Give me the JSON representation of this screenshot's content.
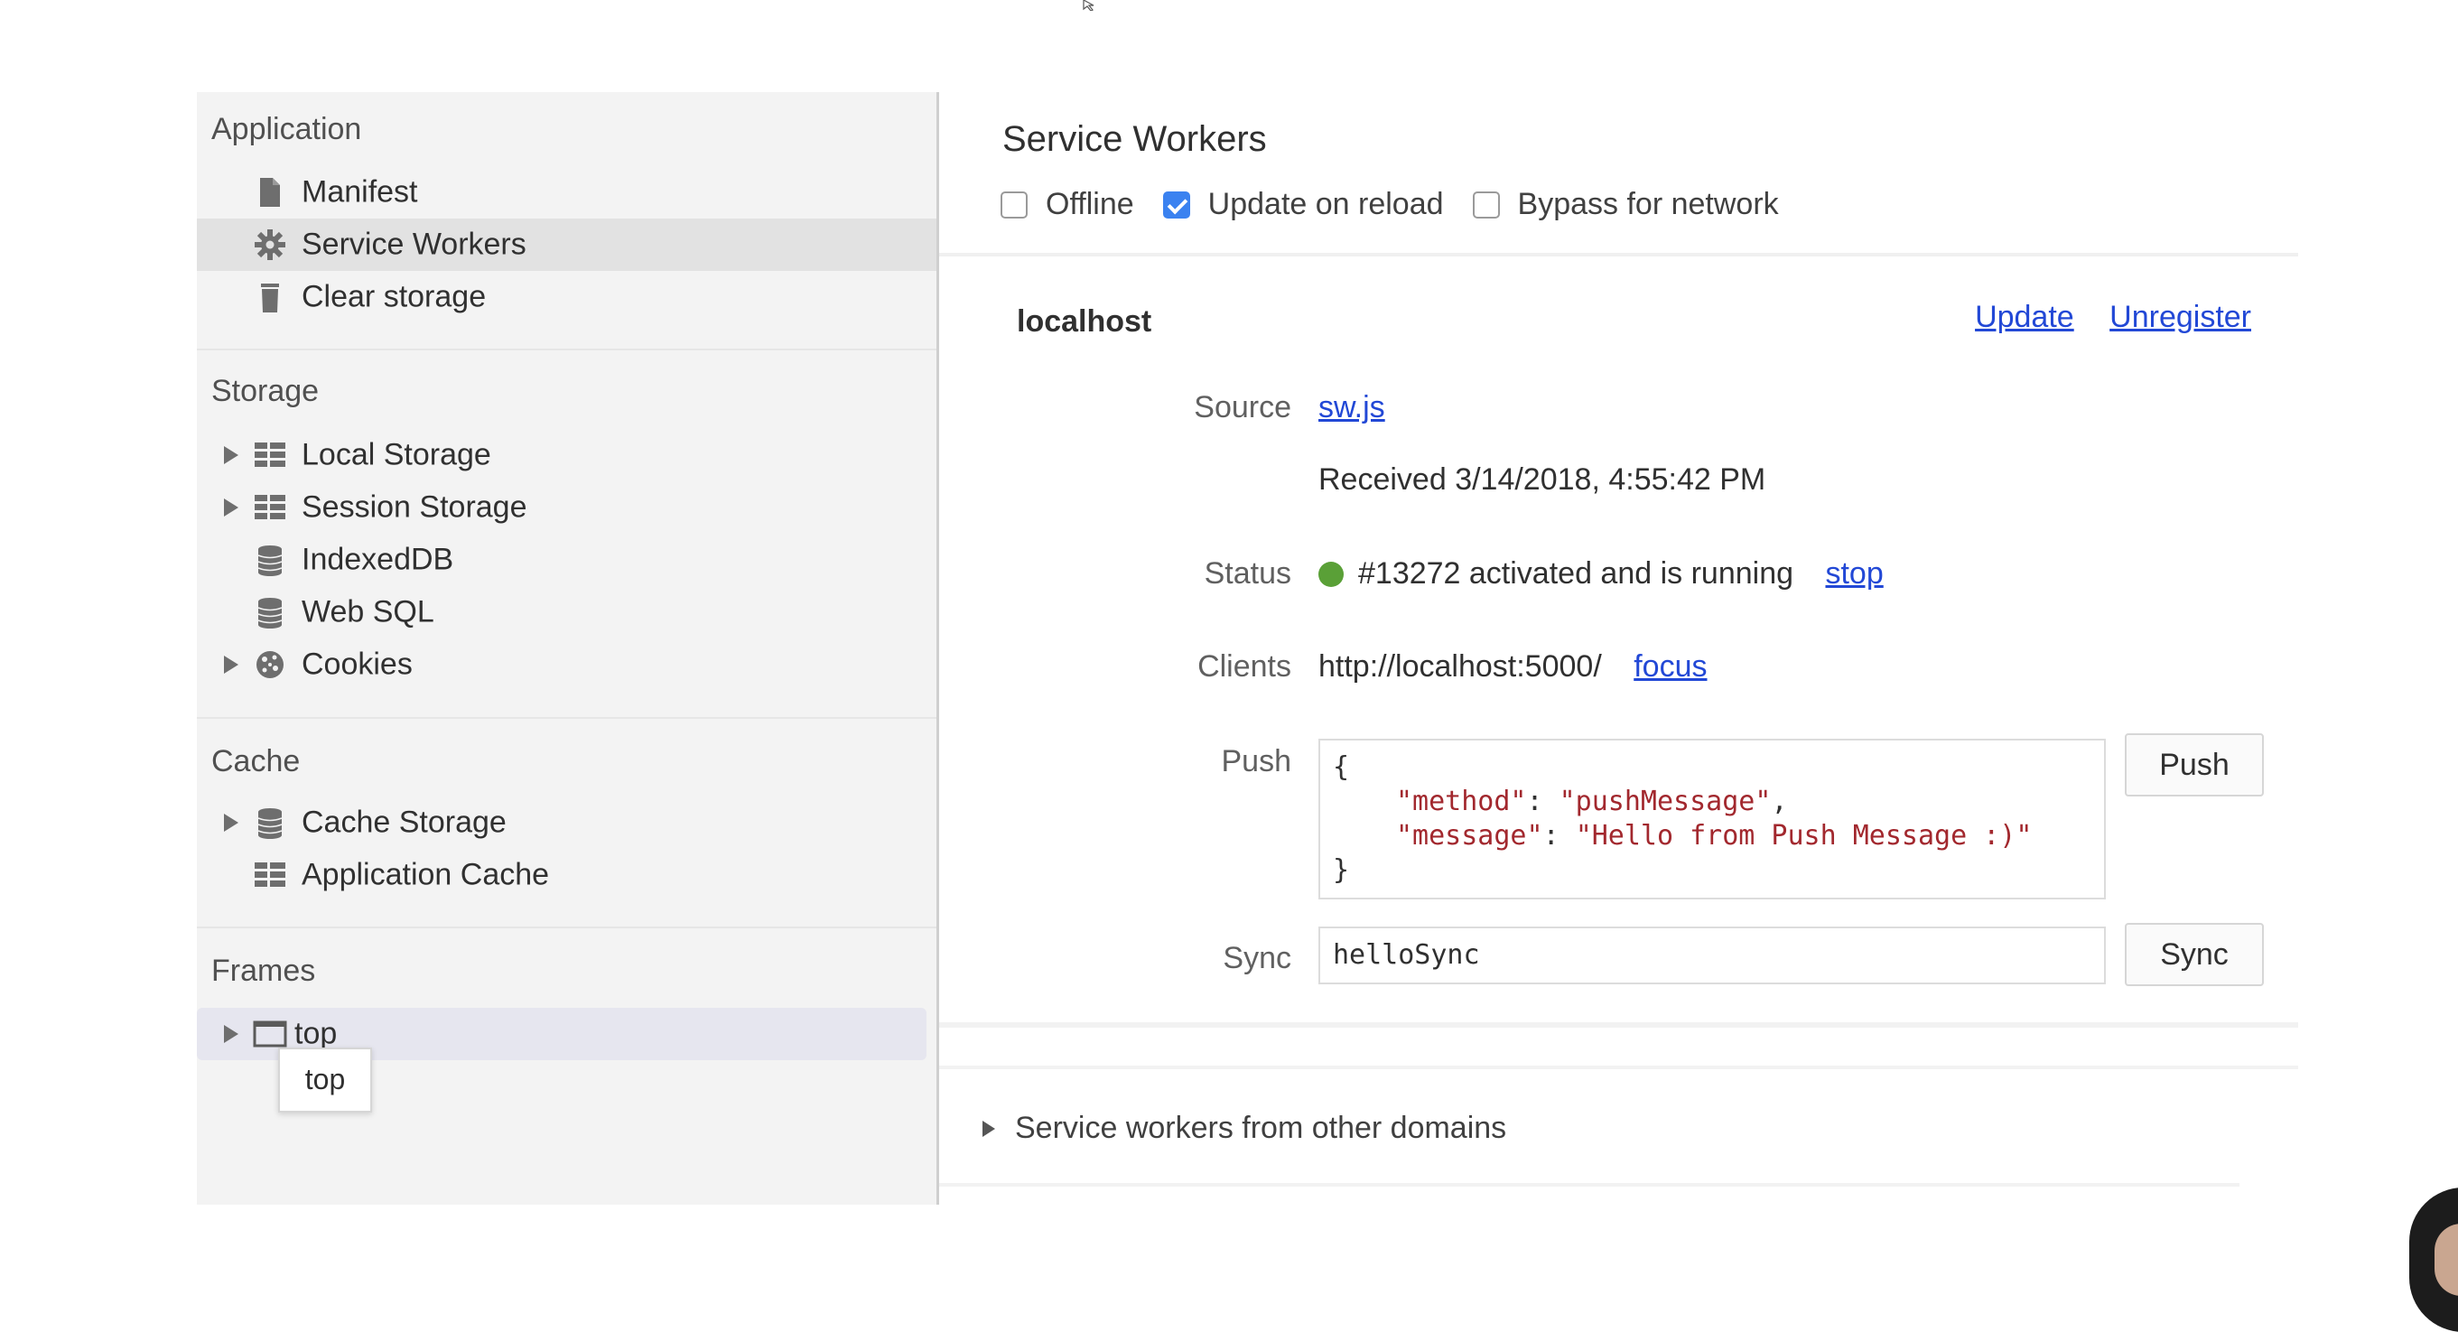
{
  "sidebar": {
    "application": {
      "title": "Application",
      "items": [
        {
          "label": "Manifest",
          "icon": "file-icon"
        },
        {
          "label": "Service Workers",
          "icon": "gear-icon",
          "selected": true
        },
        {
          "label": "Clear storage",
          "icon": "trash-icon"
        }
      ]
    },
    "storage": {
      "title": "Storage",
      "items": [
        {
          "label": "Local Storage",
          "icon": "grid-icon",
          "expandable": true
        },
        {
          "label": "Session Storage",
          "icon": "grid-icon",
          "expandable": true
        },
        {
          "label": "IndexedDB",
          "icon": "database-icon"
        },
        {
          "label": "Web SQL",
          "icon": "database-icon"
        },
        {
          "label": "Cookies",
          "icon": "cookie-icon",
          "expandable": true
        }
      ]
    },
    "cache": {
      "title": "Cache",
      "items": [
        {
          "label": "Cache Storage",
          "icon": "database-icon",
          "expandable": true
        },
        {
          "label": "Application Cache",
          "icon": "grid-icon"
        }
      ]
    },
    "frames": {
      "title": "Frames",
      "items": [
        {
          "label": "top",
          "icon": "frame-icon",
          "expandable": true
        }
      ],
      "tooltip": "top"
    }
  },
  "main": {
    "title": "Service Workers",
    "options": [
      {
        "label": "Offline",
        "checked": false
      },
      {
        "label": "Update on reload",
        "checked": true
      },
      {
        "label": "Bypass for network",
        "checked": false
      }
    ],
    "worker": {
      "origin": "localhost",
      "update_link": "Update",
      "unregister_link": "Unregister",
      "source_label": "Source",
      "source_file": "sw.js",
      "received": "Received 3/14/2018, 4:55:42 PM",
      "status_label": "Status",
      "status_text": "#13272 activated and is running",
      "status_color": "#5aa037",
      "stop_link": "stop",
      "clients_label": "Clients",
      "client_url": "http://localhost:5000/",
      "focus_link": "focus",
      "push_label": "Push",
      "push_open": "{",
      "push_line1_key": "\"method\"",
      "push_line1_val": "\"pushMessage\"",
      "push_line2_key": "\"message\"",
      "push_line2_val": "\"Hello from Push Message :)\"",
      "push_close": "}",
      "push_button": "Push",
      "sync_label": "Sync",
      "sync_value": "helloSync",
      "sync_button": "Sync"
    },
    "other_domains": "Service workers from other domains"
  },
  "colors": {
    "link": "#2248d6",
    "checkbox_checked": "#3b82f0",
    "json_string": "#a2282e"
  }
}
